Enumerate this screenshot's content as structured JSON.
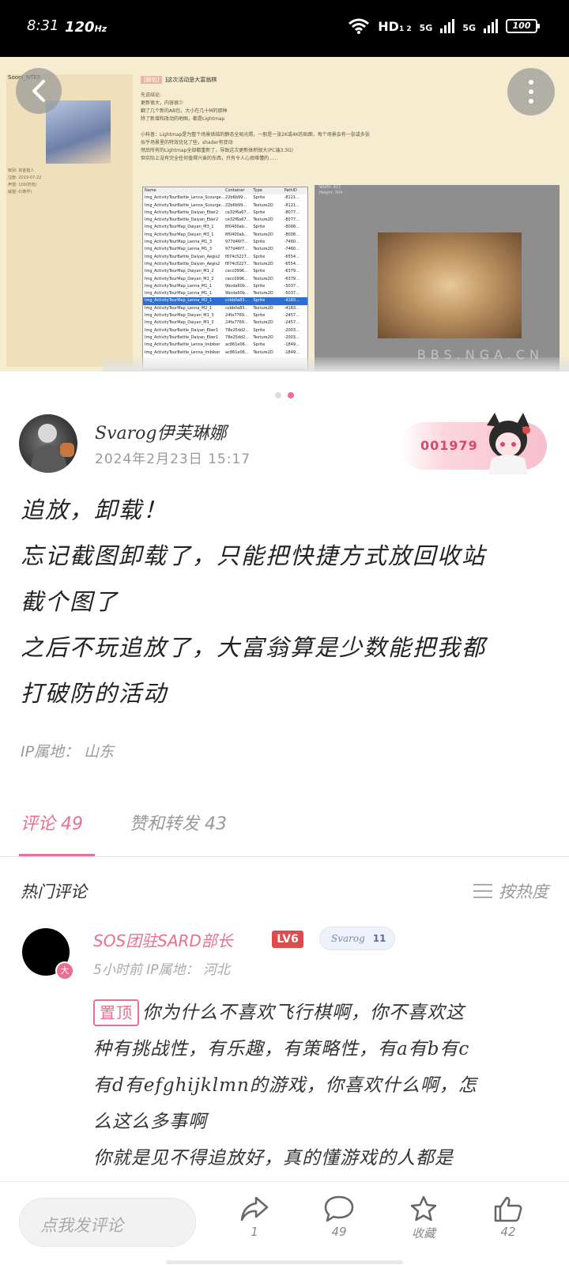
{
  "status_bar": {
    "time": "8:31",
    "refresh_rate": "120",
    "refresh_unit": "Hz",
    "network": "HD",
    "network_sub": "1 2",
    "signal1": "5G",
    "signal2": "5G",
    "battery": "100"
  },
  "hero": {
    "user_line": "Sooni_NTE5",
    "post_title_tag": "[解包]",
    "post_title": "]这次活动是大富翁棋",
    "post_text": [
      "先说结论:",
      "更新很大，内容很少",
      "翻了几个新的AB包，大小在几十M的那种",
      "除了新增和改动的地图，都是Lightmap",
      "",
      "小科普：Lightmap是为整个场景烘焙的静态全局光照，一般是一张2K或4K的贴图，每个场景会有一张或多张",
      "似乎场景里的特效优化了些，shader有变动",
      "然后所有的Lightmap全部都重新了，导致这次更新体积很大(PC端3.3G)",
      "但实际上没有完全任何值得兴奋的东西，只有令人心烦难懂的......"
    ],
    "meta": [
      "级别: 资金猎人",
      "注册: 2019-07-22",
      "声望: 100(奶包)",
      "威望: 0(寄学)"
    ],
    "table_headers": [
      "Name",
      "Container",
      "Type",
      "PathID"
    ],
    "table_rows": [
      [
        "Img_ActivityTourBattle_Lenna_Scourge...",
        "22b6b99...",
        "Sprite",
        "-8121..."
      ],
      [
        "Img_ActivityTourBattle_Lenna_Scourge...",
        "22b6b99...",
        "Texture2D",
        "-8121..."
      ],
      [
        "Img_ActivityTourBattle_Daiyan_Eber2",
        "ce32f6a67...",
        "Sprite",
        "-8077..."
      ],
      [
        "Img_ActivityTourBattle_Daiyan_Eber2",
        "ce32f6a67...",
        "Texture2D",
        "-8077..."
      ],
      [
        "Img_ActivityTourMap_Daiyan_M3_1",
        "8f0400ab...",
        "Sprite",
        "-8008..."
      ],
      [
        "Img_ActivityTourMap_Daiyan_M3_1",
        "8f0400ab...",
        "Texture2D",
        "-8008..."
      ],
      [
        "Img_ActivityTourMap_Lenna_M1_3",
        "977d46f7...",
        "Sprite",
        "-7460..."
      ],
      [
        "Img_ActivityTourMap_Lenna_M1_3",
        "977d46f7...",
        "Texture2D",
        "-7460..."
      ],
      [
        "Img_ActivityTourBattle_Daiyan_Aegis2",
        "f874c5227...",
        "Sprite",
        "-6554..."
      ],
      [
        "Img_ActivityTourBattle_Daiyan_Aegis2",
        "f874c5227...",
        "Texture2D",
        "-6554..."
      ],
      [
        "Img_ActivityTourMap_Daiyan_M1_2",
        "cecc0996...",
        "Sprite",
        "-6379..."
      ],
      [
        "Img_ActivityTourMap_Daiyan_M1_2",
        "cecc0996...",
        "Texture2D",
        "-6379..."
      ],
      [
        "Img_ActivityTourMap_Lenna_M1_1",
        "9bcda60b...",
        "Sprite",
        "-5037..."
      ],
      [
        "Img_ActivityTourMap_Lenna_M1_1",
        "9bcda60b...",
        "Texture2D",
        "-5037..."
      ],
      [
        "Img_ActivityTourMap_Lenna_M2_1",
        "ccbb0a83...",
        "Sprite",
        "-4183..."
      ],
      [
        "Img_ActivityTourMap_Lenna_M2_1",
        "ccbb0a83...",
        "Texture2D",
        "-4183..."
      ],
      [
        "Img_ActivityTourMap_Daiyan_M1_3",
        "24fa7769...",
        "Sprite",
        "-2457..."
      ],
      [
        "Img_ActivityTourMap_Daiyan_M1_3",
        "24fa7769...",
        "Texture2D",
        "-2457..."
      ],
      [
        "Img_ActivityTourBattle_Daiyan_Eber1",
        "78e25dd2...",
        "Sprite",
        "-2003..."
      ],
      [
        "Img_ActivityTourBattle_Daiyan_Eber1",
        "78e25dd2...",
        "Texture2D",
        "-2003..."
      ],
      [
        "Img_ActivityTourBattle_Lenna_Imbiber",
        "ac861e06...",
        "Sprite",
        "-1849..."
      ],
      [
        "Img_ActivityTourBattle_Lenna_Imbiber",
        "ac861e06...",
        "Texture2D",
        "-1849..."
      ]
    ],
    "selected_row_index": 14,
    "preview_dims": [
      "Width: 417",
      "Height: 304"
    ],
    "watermark": "BBS.NGA.CN"
  },
  "carousel": {
    "count": 2,
    "active_index": 1
  },
  "post": {
    "author": "Svarog伊芙琳娜",
    "date": "2024年2月23日  15:17",
    "badge_number": "001979",
    "body_lines": [
      "追放，卸载！",
      "忘记截图卸载了，只能把快捷方式放回收站",
      "截个图了",
      "之后不玩追放了，大富翁算是少数能把我都",
      "打破防的活动"
    ],
    "ip_location": "IP属地：  山东"
  },
  "tabs": {
    "comments": "评论  49",
    "likes_shares": "赞和转发  43"
  },
  "comments": {
    "section_title": "热门评论",
    "sort_label": "按热度",
    "items": [
      {
        "name": "SOS团驻SARD部长",
        "level": "LV6",
        "avatar_mark": "大",
        "fan_tag_name": "Svarog",
        "fan_tag_level": "11",
        "meta": "5小时前    IP属地：  河北",
        "pin_label": "置顶",
        "lines": [
          "你为什么不喜欢飞行棋啊，你不喜欢这",
          "种有挑战性，有乐趣，有策略性，有a有b有c",
          "有d有efghijklmn的游戏，你喜欢什么啊，怎",
          "么这么多事啊",
          "你就是见不得追放好，真的懂游戏的人都是"
        ]
      }
    ]
  },
  "bottom_bar": {
    "input_placeholder": "点我发评论",
    "share_count": "1",
    "comment_count": "49",
    "favorite_label": "收藏",
    "like_count": "42"
  },
  "colors": {
    "accent": "#e8718f",
    "level_badge": "#e14a4a",
    "muted_text": "#999999"
  }
}
